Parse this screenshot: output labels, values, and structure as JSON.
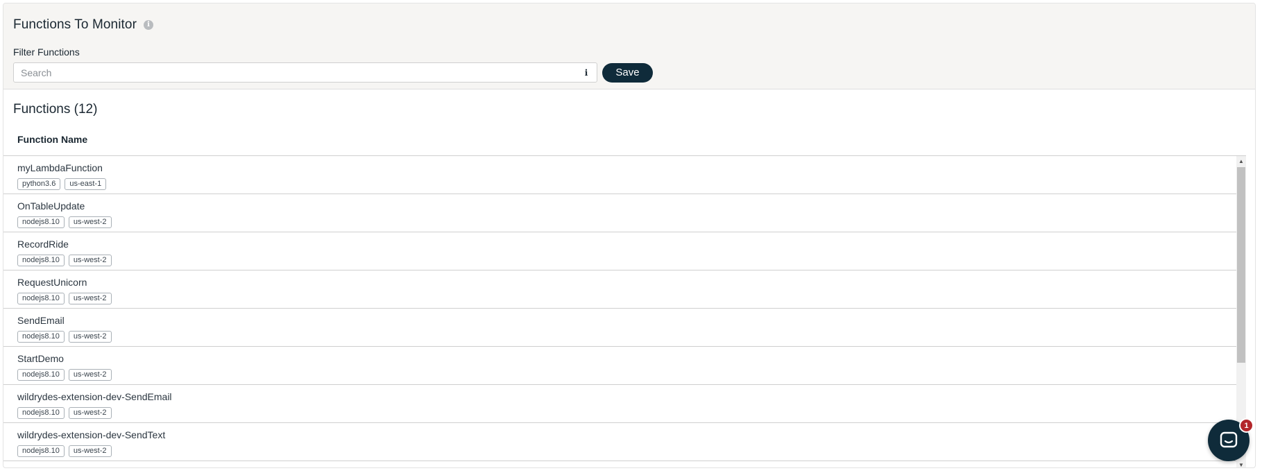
{
  "header": {
    "title": "Functions To Monitor",
    "info_icon": "info-icon",
    "filter_label": "Filter Functions",
    "search_placeholder": "Search",
    "save_label": "Save"
  },
  "list": {
    "title": "Functions (12)",
    "column_header": "Function Name",
    "rows": [
      {
        "name": "myLambdaFunction",
        "runtime": "python3.6",
        "region": "us-east-1"
      },
      {
        "name": "OnTableUpdate",
        "runtime": "nodejs8.10",
        "region": "us-west-2"
      },
      {
        "name": "RecordRide",
        "runtime": "nodejs8.10",
        "region": "us-west-2"
      },
      {
        "name": "RequestUnicorn",
        "runtime": "nodejs8.10",
        "region": "us-west-2"
      },
      {
        "name": "SendEmail",
        "runtime": "nodejs8.10",
        "region": "us-west-2"
      },
      {
        "name": "StartDemo",
        "runtime": "nodejs8.10",
        "region": "us-west-2"
      },
      {
        "name": "wildrydes-extension-dev-SendEmail",
        "runtime": "nodejs8.10",
        "region": "us-west-2"
      },
      {
        "name": "wildrydes-extension-dev-SendText",
        "runtime": "nodejs8.10",
        "region": "us-west-2"
      }
    ]
  },
  "chat": {
    "icon": "chat-icon",
    "badge_count": "1"
  },
  "colors": {
    "primary": "#0f2b3a",
    "badge": "#b3262a",
    "header_bg": "#f6f5f3"
  }
}
